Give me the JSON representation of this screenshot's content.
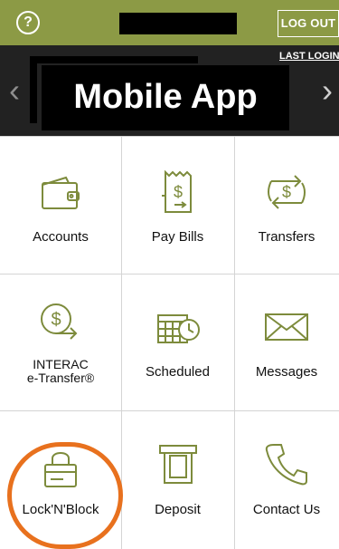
{
  "header": {
    "help_symbol": "?",
    "logout_label": "LOG OUT"
  },
  "banner": {
    "last_login_label": "LAST LOGIN",
    "title": "Mobile App"
  },
  "menu": {
    "items": [
      {
        "label": "Accounts",
        "icon": "wallet-icon"
      },
      {
        "label": "Pay Bills",
        "icon": "bill-icon"
      },
      {
        "label": "Transfers",
        "icon": "transfer-icon"
      },
      {
        "label_line1": "INTERAC",
        "label_line2": "e-Transfer®",
        "icon": "interac-transfer-icon"
      },
      {
        "label": "Scheduled",
        "icon": "calendar-clock-icon"
      },
      {
        "label": "Messages",
        "icon": "envelope-icon"
      },
      {
        "label": "Lock'N'Block",
        "icon": "lock-card-icon"
      },
      {
        "label": "Deposit",
        "icon": "atm-deposit-icon"
      },
      {
        "label": "Contact Us",
        "icon": "phone-icon"
      }
    ]
  },
  "colors": {
    "brand_green": "#8c9a45",
    "icon_green": "#7d8b3c",
    "highlight_orange": "#e8711e"
  }
}
